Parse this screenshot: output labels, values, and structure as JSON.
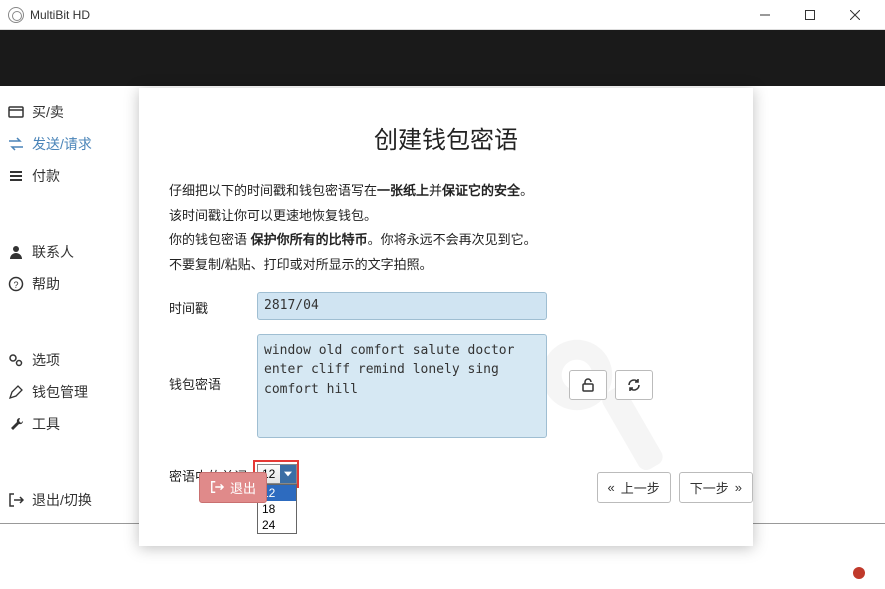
{
  "window": {
    "title": "MultiBit HD"
  },
  "sidebar": {
    "items": [
      {
        "label": "买/卖"
      },
      {
        "label": "发送/请求"
      },
      {
        "label": "付款"
      }
    ],
    "group2": [
      {
        "label": "联系人"
      },
      {
        "label": "帮助"
      }
    ],
    "group3": [
      {
        "label": "选项"
      },
      {
        "label": "钱包管理"
      },
      {
        "label": "工具"
      }
    ],
    "group4": [
      {
        "label": "退出/切换"
      }
    ]
  },
  "modal": {
    "title": "创建钱包密语",
    "instr1_pre": "仔细把以下的时间戳和钱包密语写在",
    "instr1_bold1": "一张纸上",
    "instr1_mid": "并",
    "instr1_bold2": "保证它的安全",
    "instr1_end": "。",
    "instr2": "该时间戳让你可以更速地恢复钱包。",
    "instr3_pre": "你的钱包密语 ",
    "instr3_bold": "保护你所有的比特币",
    "instr3_end": "。你将永远不会再次见到它。",
    "instr4": "不要复制/粘贴、打印或对所显示的文字拍照。",
    "label_timestamp": "时间戳",
    "value_timestamp": "2817/04",
    "label_phrase": "钱包密语",
    "value_phrase": "window old comfort salute doctor\nenter cliff remind lonely sing\ncomfort hill",
    "label_wordcount": "密语中的单词",
    "select_value": "12",
    "options": [
      "12",
      "18",
      "24"
    ],
    "btn_exit": "退出",
    "btn_prev": "上一步",
    "btn_next": "下一步",
    "chev_left": "«",
    "chev_right": "»"
  }
}
